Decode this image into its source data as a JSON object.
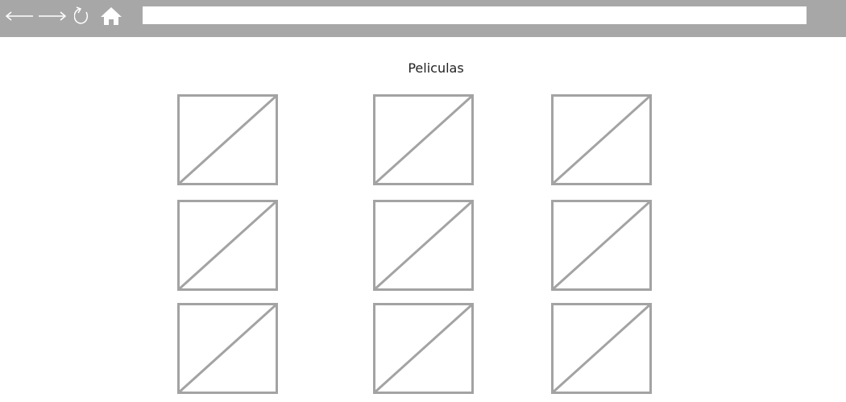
{
  "toolbar": {
    "icons": [
      "back-arrow-icon",
      "forward-arrow-icon",
      "refresh-icon",
      "home-icon"
    ],
    "address_value": ""
  },
  "page": {
    "title": "Peliculas"
  },
  "movies": {
    "count": 9,
    "placeholder_icon": "image-placeholder-icon"
  },
  "colors": {
    "toolbar_bg": "#a7a7a7",
    "placeholder_stroke": "#a3a3a3",
    "address_bg": "#ffffff"
  }
}
